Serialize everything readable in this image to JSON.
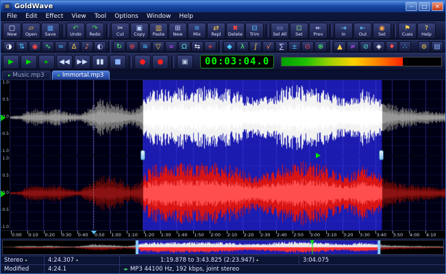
{
  "window": {
    "title": "GoldWave",
    "icon_glyph": "≋",
    "controls": [
      {
        "name": "minimize",
        "glyph": "–"
      },
      {
        "name": "maximize",
        "glyph": "□"
      },
      {
        "name": "close",
        "glyph": "✕"
      }
    ]
  },
  "menu": {
    "items": [
      "File",
      "Edit",
      "Effect",
      "View",
      "Tool",
      "Options",
      "Window",
      "Help"
    ]
  },
  "toolbar_main": {
    "buttons": [
      {
        "name": "new",
        "label": "New",
        "glyph": "▢",
        "color": "#e8ecff"
      },
      {
        "name": "open",
        "label": "Open",
        "glyph": "▱",
        "color": "#ffd24a"
      },
      {
        "name": "save",
        "label": "Save",
        "glyph": "▦",
        "color": "#5a9cf0",
        "sep_after": true
      },
      {
        "name": "undo",
        "label": "Undo",
        "glyph": "↶",
        "color": "#46d24a"
      },
      {
        "name": "redo",
        "label": "Redo",
        "glyph": "↷",
        "color": "#46d24a",
        "sep_after": true
      },
      {
        "name": "cut",
        "label": "Cut",
        "glyph": "✂",
        "color": "#e6e6e6"
      },
      {
        "name": "copy",
        "label": "Copy",
        "glyph": "▣",
        "color": "#bcd0ff"
      },
      {
        "name": "paste",
        "label": "Paste",
        "glyph": "▥",
        "color": "#e0b85a"
      },
      {
        "name": "paste-new",
        "label": "New",
        "glyph": "⊞",
        "color": "#cfd6ff"
      },
      {
        "name": "mix",
        "label": "Mix",
        "glyph": "≋",
        "color": "#54b4ff"
      },
      {
        "name": "replace",
        "label": "Repl",
        "glyph": "⇄",
        "color": "#ffd24a"
      },
      {
        "name": "delete",
        "label": "Delete",
        "glyph": "✖",
        "color": "#ff4848"
      },
      {
        "name": "trim",
        "label": "Trim",
        "glyph": "⊟",
        "color": "#54c4ff",
        "sep_after": true
      },
      {
        "name": "select-all",
        "label": "Sel All",
        "glyph": "▭",
        "color": "#9ab4ff"
      },
      {
        "name": "set-selection",
        "label": "Set",
        "glyph": "⊡",
        "color": "#8cd88c"
      },
      {
        "name": "prev",
        "label": "Prev",
        "glyph": "↞",
        "color": "#c4c8ff",
        "sep_after": true
      },
      {
        "name": "marker-in",
        "label": "In",
        "glyph": "⇥",
        "color": "#5ac8ff"
      },
      {
        "name": "marker-out",
        "label": "Out",
        "glyph": "⇤",
        "color": "#5ac8ff"
      },
      {
        "name": "marker-set",
        "label": "Set",
        "glyph": "◉",
        "color": "#ffa44a",
        "sep_after": true
      },
      {
        "name": "cues",
        "label": "Cues",
        "glyph": "⚑",
        "color": "#ffd24a"
      },
      {
        "name": "help",
        "label": "Help",
        "glyph": "?",
        "color": "#ffe44a"
      }
    ]
  },
  "toolbar_effects": {
    "icons": [
      {
        "glyph": "◑",
        "color": "#ffffff"
      },
      {
        "glyph": "⇅",
        "color": "#4ac8ff"
      },
      {
        "glyph": "◉",
        "color": "#ff4a4a"
      },
      {
        "glyph": "∿",
        "color": "#4aff6a"
      },
      {
        "glyph": "≈",
        "color": "#4ac8ff"
      },
      {
        "glyph": "Δ",
        "color": "#ffd24a"
      },
      {
        "glyph": "♪",
        "color": "#ff8c4a"
      },
      {
        "glyph": "◐",
        "color": "#c8c8ff",
        "sep_after": true
      },
      {
        "glyph": "↻",
        "color": "#4aff6a"
      },
      {
        "glyph": "⊕",
        "color": "#ff4a4a"
      },
      {
        "glyph": "≋",
        "color": "#4ac8ff"
      },
      {
        "glyph": "▽",
        "color": "#ffd24a"
      },
      {
        "glyph": "∞",
        "color": "#c84aff"
      },
      {
        "glyph": "Ω",
        "color": "#4ae0d0"
      },
      {
        "glyph": "⇆",
        "color": "#ffffff"
      },
      {
        "glyph": "+",
        "color": "#ff4a4a",
        "sep_after": true
      },
      {
        "glyph": "◆",
        "color": "#4ac8ff"
      },
      {
        "glyph": "λ",
        "color": "#4aff6a"
      },
      {
        "glyph": "∫",
        "color": "#ffd24a"
      },
      {
        "glyph": "√",
        "color": "#ff8c4a"
      },
      {
        "glyph": "∑",
        "color": "#c8c8ff"
      },
      {
        "glyph": "±",
        "color": "#4ac8ff"
      },
      {
        "glyph": "⊙",
        "color": "#ff4a4a"
      },
      {
        "glyph": "⊗",
        "color": "#4aff6a",
        "sep_after": true
      },
      {
        "glyph": "▲",
        "color": "#ffd24a"
      },
      {
        "glyph": "≠",
        "color": "#c84aff"
      },
      {
        "glyph": "⊘",
        "color": "#4ae0d0"
      },
      {
        "glyph": "◈",
        "color": "#ffffff"
      },
      {
        "glyph": "♦",
        "color": "#ff4a4a"
      },
      {
        "glyph": "∴",
        "color": "#4ac8ff"
      },
      {
        "glyph": "⊚",
        "color": "#ffd24a",
        "right": true
      },
      {
        "glyph": "▤",
        "color": "#8cb4ff"
      }
    ]
  },
  "transport": {
    "time_display": "00:03:04.0",
    "meter_percent": 76,
    "buttons": [
      {
        "name": "play",
        "glyph": "▶",
        "color": "#00e000"
      },
      {
        "name": "play-all",
        "glyph": "▶",
        "color": "#00e000"
      },
      {
        "name": "play-selection",
        "glyph": "▸",
        "color": "#00c000"
      },
      {
        "name": "rewind",
        "glyph": "◀◀",
        "color": "#cfe0ff"
      },
      {
        "name": "fast-forward",
        "glyph": "▶▶",
        "color": "#cfe0ff"
      },
      {
        "name": "pause",
        "glyph": "▮▮",
        "color": "#cfe0ff"
      },
      {
        "name": "stop",
        "glyph": "■",
        "color": "#8cb4ff",
        "sep_after": true
      },
      {
        "name": "record",
        "glyph": "●",
        "color": "#ff2020"
      },
      {
        "name": "record-new",
        "glyph": "●",
        "color": "#ff2020",
        "sep_after": true
      },
      {
        "name": "monitor",
        "glyph": "▣",
        "color": "#b8c8e0"
      }
    ]
  },
  "tabs": [
    {
      "label": "Music.mp3",
      "active": false,
      "icon_glyph": "▸"
    },
    {
      "label": "Immortal.mp3",
      "active": true,
      "icon_glyph": "▸"
    }
  ],
  "editor": {
    "amplitude_labels": [
      "1.0",
      "0.5",
      "0.0",
      "-0.5",
      "-1.0"
    ],
    "time_labels": [
      "0:00",
      "0:10",
      "0:20",
      "0:30",
      "0:40",
      "0:50",
      "1:00",
      "1:10",
      "1:20",
      "1:30",
      "1:40",
      "1:50",
      "2:00",
      "2:10",
      "2:20",
      "2:30",
      "2:40",
      "2:50",
      "3:00",
      "3:10",
      "3:20",
      "3:30",
      "3:40",
      "3:50",
      "4:00",
      "4:10"
    ],
    "timeline": {
      "duration_s": 262,
      "selection_start_s": 79.878,
      "selection_end_s": 223.825,
      "playhead_s": 184,
      "cue_s": 50
    },
    "colors": {
      "background": "#000014",
      "selection_bg": "#1b1bb0",
      "left_wave": "#f2f2f2",
      "left_wave_core": "#ffffff",
      "left_wave_dim": "#6e6e6e",
      "left_wave_dim_core": "#989898",
      "right_wave": "#d81414",
      "right_wave_core": "#ff4e4e",
      "right_wave_dim": "#5e0808",
      "right_wave_dim_core": "#8a1212"
    }
  },
  "status_primary": {
    "channels": "Stereo",
    "length": "4:24.307",
    "selection": "1:19.878 to 3:43.825 (2:23.947)",
    "position": "3:04.075"
  },
  "status_secondary": {
    "state": "Modified",
    "length": "4:24.1",
    "format": "MP3 44100 Hz, 192 kbps, joint stereo"
  },
  "icons": {
    "spinner": "▴",
    "format_nav": "◂▸"
  }
}
